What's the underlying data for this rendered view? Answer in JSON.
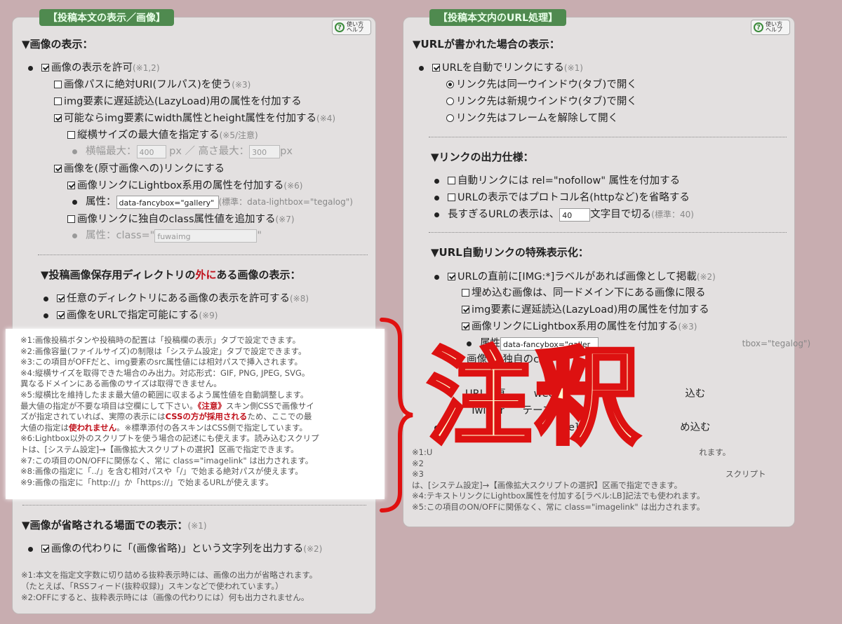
{
  "left": {
    "tab_title": "【投稿本文の表示／画像】",
    "help": {
      "line1": "使い方",
      "line2": "ヘルプ",
      "icon": "question-circle-icon"
    },
    "section1_heading": "▼画像の表示：",
    "allow_images": {
      "label": "画像の表示を許可",
      "note": "(※1,2)"
    },
    "absolute_uri": {
      "label": "画像パスに絶対URI(フルパス)を使う",
      "note": "(※3)"
    },
    "lazyload": {
      "label": "img要素に遅延読込(LazyLoad)用の属性を付加する"
    },
    "width_height": {
      "label": "可能ならimg要素にwidth属性とheight属性を付加する",
      "note": "(※4)"
    },
    "max_size": {
      "label": "縦横サイズの最大値を指定する",
      "note": "(※5/注意)"
    },
    "max_dims": {
      "width_label": "横幅最大：",
      "width_value": "400",
      "unit1": "px ／ 高さ最大：",
      "height_value": "300",
      "unit2": "px"
    },
    "link_original": {
      "label": "画像を(原寸画像への)リンクにする"
    },
    "lightbox": {
      "label": "画像リンクにLightbox系用の属性を付加する",
      "note": "(※6)"
    },
    "attr": {
      "label": "属性：",
      "value": "data-fancybox=\"gallery\"",
      "note": "(標準：data-lightbox=\"tegalog\")"
    },
    "custom_class": {
      "label": "画像リンクに独自のclass属性値を追加する",
      "note": "(※7)"
    },
    "class_attr": {
      "label": "属性：class=\"",
      "value": "fuwaimg",
      "end": "\""
    },
    "section2_heading_a": "▼投稿画像保存用ディレクトリの",
    "section2_heading_red": "外に",
    "section2_heading_b": "ある画像の表示：",
    "any_dir": {
      "label": "任意のディレクトリにある画像の表示を許可する",
      "note": "(※8)"
    },
    "by_url": {
      "label": "画像をURLで指定可能にする",
      "note": "(※9)"
    },
    "notes": [
      "※1:画像投稿ボタンや投稿時の配置は「投稿欄の表示」タブで設定できます。",
      "※2:画像容量(ファイルサイズ)の制限は「システム設定」タブで設定できます。",
      "※3:この項目がOFFだと、img要素のsrc属性値には相対パスで挿入されます。",
      "※4:縦横サイズを取得できた場合のみ出力。対応形式：GIF, PNG, JPEG, SVG。",
      "異なるドメインにある画像のサイズは取得できません。",
      "※5:縦横比を維持したまま最大値の範囲に収まるよう属性値を自動調整します。",
      "最大値の指定が不要な項目は空欄にして下さい。"
    ],
    "note5_red1": "《注意》",
    "note5_cont1": "スキン側CSSで画像サイ",
    "note5_line2a": "ズが指定されていれば、実際の表示には",
    "note5_red2": "CSSの方が採用される",
    "note5_line2b": "ため、ここでの最",
    "note5_line3a": "大値の指定は",
    "note5_red3": "使われません",
    "note5_line3b": "。※標準添付の各スキンはCSS側で指定しています。",
    "notes_after": [
      "※6:Lightbox以外のスクリプトを使う場合の記述にも使えます。読み込むスクリプ",
      "トは、[システム設定]→【画像拡大スクリプトの選択】区画で指定できます。",
      "※7:この項目のON/OFFに関係なく、常に class=\"imagelink\" は出力されます。",
      "※8:画像の指定に「../」を含む相対パスや「/」で始まる絶対パスが使えます。",
      "※9:画像の指定に「http://」か「https://」で始まるURLが使えます。"
    ],
    "section3_heading": "▼画像が省略される場面での表示：",
    "section3_note": "(※1)",
    "alt_text": {
      "label": "画像の代わりに「(画像省略)」という文字列を出力する",
      "note": "(※2)"
    },
    "bottom_notes": [
      "※1:本文を指定文字数に切り詰める抜粋表示時には、画像の出力が省略されます。",
      "（たとえば、「RSSフィード(抜粋収録)」スキンなどで使われています。）",
      "※2:OFFにすると、抜粋表示時には（画像の代わりには）何も出力されません。"
    ]
  },
  "right": {
    "tab_title": "【投稿本文内のURL処理】",
    "help": {
      "line1": "使い方",
      "line2": "ヘルプ",
      "icon": "question-circle-icon"
    },
    "section1_heading": "▼URLが書かれた場合の表示：",
    "autolink": {
      "label": "URLを自動でリンクにする",
      "note": "(※1)"
    },
    "radio_same": "リンク先は同一ウインドウ(タブ)で開く",
    "radio_new": "リンク先は新規ウインドウ(タブ)で開く",
    "radio_frame": "リンク先はフレームを解除して開く",
    "section2_heading": "▼リンクの出力仕様：",
    "nofollow": "自動リンクには rel=\"nofollow\" 属性を付加する",
    "omit_protocol": "URLの表示ではプロトコル名(httpなど)を省略する",
    "truncate": {
      "label_a": "長すぎるURLの表示は、",
      "value": "40",
      "label_b": "文字目で切る",
      "note": "(標準：40)"
    },
    "section3_heading": "▼URL自動リンクの特殊表示化：",
    "img_label": {
      "label": "URLの直前に[IMG:*]ラベルがあれば画像として掲載",
      "note": "(※2)"
    },
    "same_domain": "埋め込む画像は、同一ドメイン下にある画像に限る",
    "lazyload": "img要素に遅延読込(LazyLoad)用の属性を付加する",
    "lightbox": {
      "label": "画像リンクにLightbox系用の属性を付加する",
      "note": "(※3)"
    },
    "attr_partial": {
      "label": "属性",
      "value": "data-fancybox=\"galler",
      "tail": "tbox=\"tegalog\")"
    },
    "hidden_row1": "画像",
    "hidden_row1b": "独自のc",
    "hidden_row2": "URLの直",
    "hidden_row2b": "weet]ラ",
    "hidden_row2c": "込む",
    "hidden_row3": "Twitter",
    "hidden_row3b": "テーマ：",
    "hidden_row4b": "e]ラ",
    "hidden_row4c": "め込む",
    "notes_partial": [
      "※1:U",
      "※2",
      "※3",
      "は、[システム設定]→【画像拡大スクリプトの選択】区画で指定できます。",
      "※4:テキストリンクにLightbox属性を付加する[ラベル:LB]記法でも使われます。",
      "※5:この項目のON/OFFに関係なく、常に class=\"imagelink\" は出力されます。"
    ],
    "notes_partial_tail1": "れます。",
    "notes_partial_tail2": "スクリプト"
  },
  "overlay": {
    "text": "注釈",
    "color_fill": "#fffbd0",
    "color_stroke": "#dd1111"
  }
}
